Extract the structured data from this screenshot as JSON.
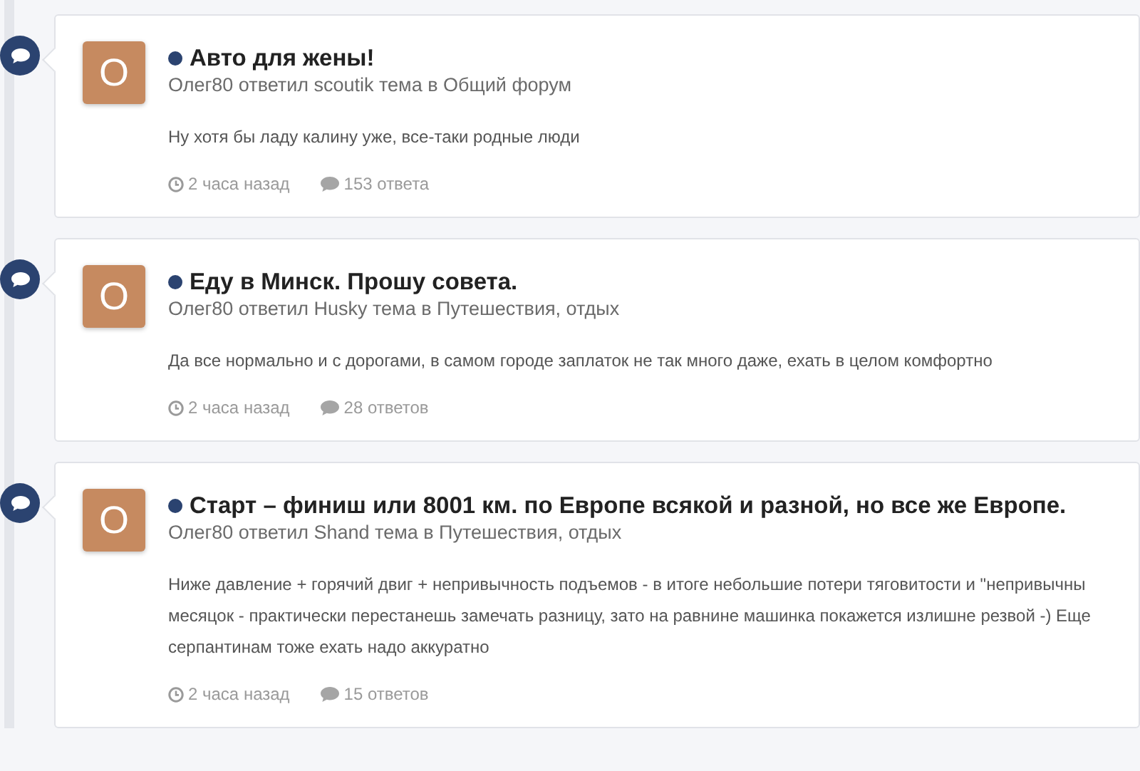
{
  "activity": [
    {
      "avatar_letter": "O",
      "title": "Авто для жены!",
      "meta": "Олег80 ответил scoutik тема в Общий форум",
      "excerpt": "Ну хотя бы ладу калину уже, все-таки родные люди",
      "time": "2 часа назад",
      "replies": "153 ответа"
    },
    {
      "avatar_letter": "O",
      "title": "Еду в Минск. Прошу совета.",
      "meta": "Олег80 ответил Husky тема в Путешествия, отдых",
      "excerpt": "Да все нормально и с дорогами, в самом городе заплаток не так много даже, ехать в целом комфортно",
      "time": "2 часа назад",
      "replies": "28 ответов"
    },
    {
      "avatar_letter": "O",
      "title": "Старт – финиш или 8001 км. по Европе всякой и разной, но все же Европе.",
      "meta": "Олег80 ответил Shand тема в Путешествия, отдых",
      "excerpt": "Ниже давление + горячий двиг + непривычность подъемов - в итоге небольшие потери тяговитости и \"непривычны\nмесяцок - практически перестанешь замечать разницу, зато на равнине машинка покажется излишне резвой -) Еще\nсерпантинам тоже ехать надо аккуратно",
      "time": "2 часа назад",
      "replies": "15 ответов"
    }
  ]
}
